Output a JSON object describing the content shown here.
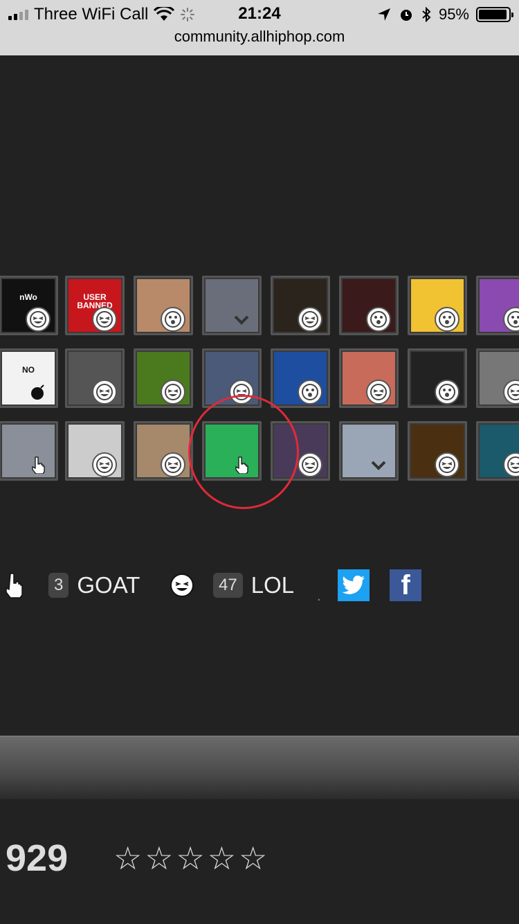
{
  "status_bar": {
    "carrier": "Three WiFi Call",
    "time": "21:24",
    "battery_pct": "95%",
    "battery_level": 0.95
  },
  "url": "community.allhiphop.com",
  "avatars": {
    "rows": [
      [
        {
          "label": "nWo",
          "bg": "#111111",
          "react": "laugh"
        },
        {
          "label": "USER BANNED",
          "bg": "#c8161d",
          "react": "laugh"
        },
        {
          "label": "",
          "bg": "#b88a6a",
          "react": "surprised"
        },
        {
          "label": "",
          "bg": "#6a6d7a",
          "react": "check"
        },
        {
          "label": "",
          "bg": "#2a241c",
          "react": "laugh"
        },
        {
          "label": "",
          "bg": "#3a1a1a",
          "react": "surprised"
        },
        {
          "label": "",
          "bg": "#f1c232",
          "react": "surprised"
        },
        {
          "label": "",
          "bg": "#8a4ab0",
          "react": "surprised"
        }
      ],
      [
        {
          "label": "NO",
          "bg": "#f2f2f2",
          "react": "bomb"
        },
        {
          "label": "",
          "bg": "#555555",
          "react": "laugh"
        },
        {
          "label": "",
          "bg": "#4b7a1e",
          "react": "laugh"
        },
        {
          "label": "",
          "bg": "#4a5a78",
          "react": "laugh"
        },
        {
          "label": "",
          "bg": "#1d4ea0",
          "react": "surprised"
        },
        {
          "label": "",
          "bg": "#c96b5a",
          "react": "laugh"
        },
        {
          "label": "",
          "bg": "#222222",
          "react": "surprised"
        },
        {
          "label": "",
          "bg": "#777777",
          "react": "laugh"
        }
      ],
      [
        {
          "label": "",
          "bg": "#8a8f99",
          "react": "hand"
        },
        {
          "label": "",
          "bg": "#cccccc",
          "react": "laugh"
        },
        {
          "label": "",
          "bg": "#a6896b",
          "react": "laugh"
        },
        {
          "label": "",
          "bg": "#2bb05a",
          "react": "hand"
        },
        {
          "label": "",
          "bg": "#4a3a5a",
          "react": "laugh"
        },
        {
          "label": "",
          "bg": "#9aa6b5",
          "react": "check"
        },
        {
          "label": "",
          "bg": "#4a3010",
          "react": "laugh"
        },
        {
          "label": "",
          "bg": "#1a5a6a",
          "react": "laugh"
        }
      ]
    ]
  },
  "reactions": {
    "goat_count": "3",
    "goat_label": "GOAT",
    "lol_count": "47",
    "lol_label": "LOL",
    "separator": "."
  },
  "share": {
    "twitter_icon": "twitter-icon",
    "facebook_icon": "facebook-icon",
    "facebook_glyph": "f"
  },
  "footer": {
    "count": "929",
    "stars": [
      "☆",
      "☆",
      "☆",
      "☆",
      "☆"
    ]
  },
  "colors": {
    "background": "#222222",
    "highlight_circle": "#e02a3a",
    "twitter": "#1da1f2",
    "facebook": "#3b5998"
  }
}
